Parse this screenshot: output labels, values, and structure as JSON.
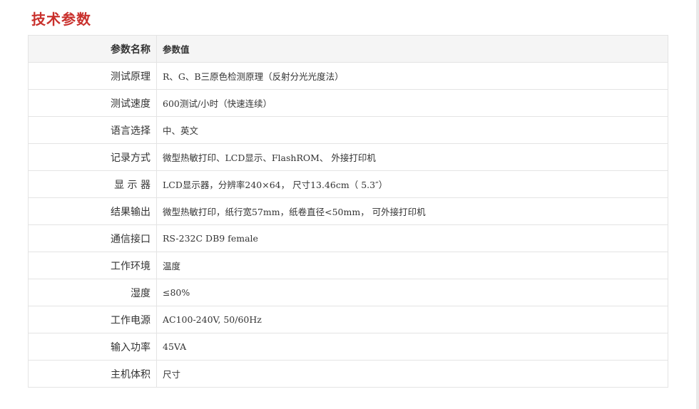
{
  "section": {
    "title": "技术参数"
  },
  "table": {
    "headers": {
      "name": "参数名称",
      "value": "参数值"
    },
    "rows": [
      {
        "name": "测试原理",
        "value": "R、G、B三原色检测原理（反射分光光度法）"
      },
      {
        "name": "测试速度",
        "value": "600测试/小时（快速连续）"
      },
      {
        "name": "语言选择",
        "value": "中、英文"
      },
      {
        "name": "记录方式",
        "value": "微型热敏打印、LCD显示、FlashROM、 外接打印机"
      },
      {
        "name": "显 示 器",
        "value": "LCD显示器，分辨率240×64， 尺寸13.46cm（ 5.3″）"
      },
      {
        "name": "结果输出",
        "value": "微型热敏打印，纸行宽57mm，纸卷直径<50mm， 可外接打印机"
      },
      {
        "name": "通信接口",
        "value": "RS-232C DB9 female"
      },
      {
        "name": "工作环境",
        "value": "温度"
      },
      {
        "name": "湿度",
        "value": "≤80%"
      },
      {
        "name": "工作电源",
        "value": "AC100-240V, 50/60Hz"
      },
      {
        "name": "输入功率",
        "value": "45VA"
      },
      {
        "name": "主机体积",
        "value": "尺寸"
      }
    ]
  },
  "colors": {
    "title": "#c9302c",
    "header_bg": "#f5f5f5",
    "border": "#e4e4e4",
    "text": "#333333"
  }
}
